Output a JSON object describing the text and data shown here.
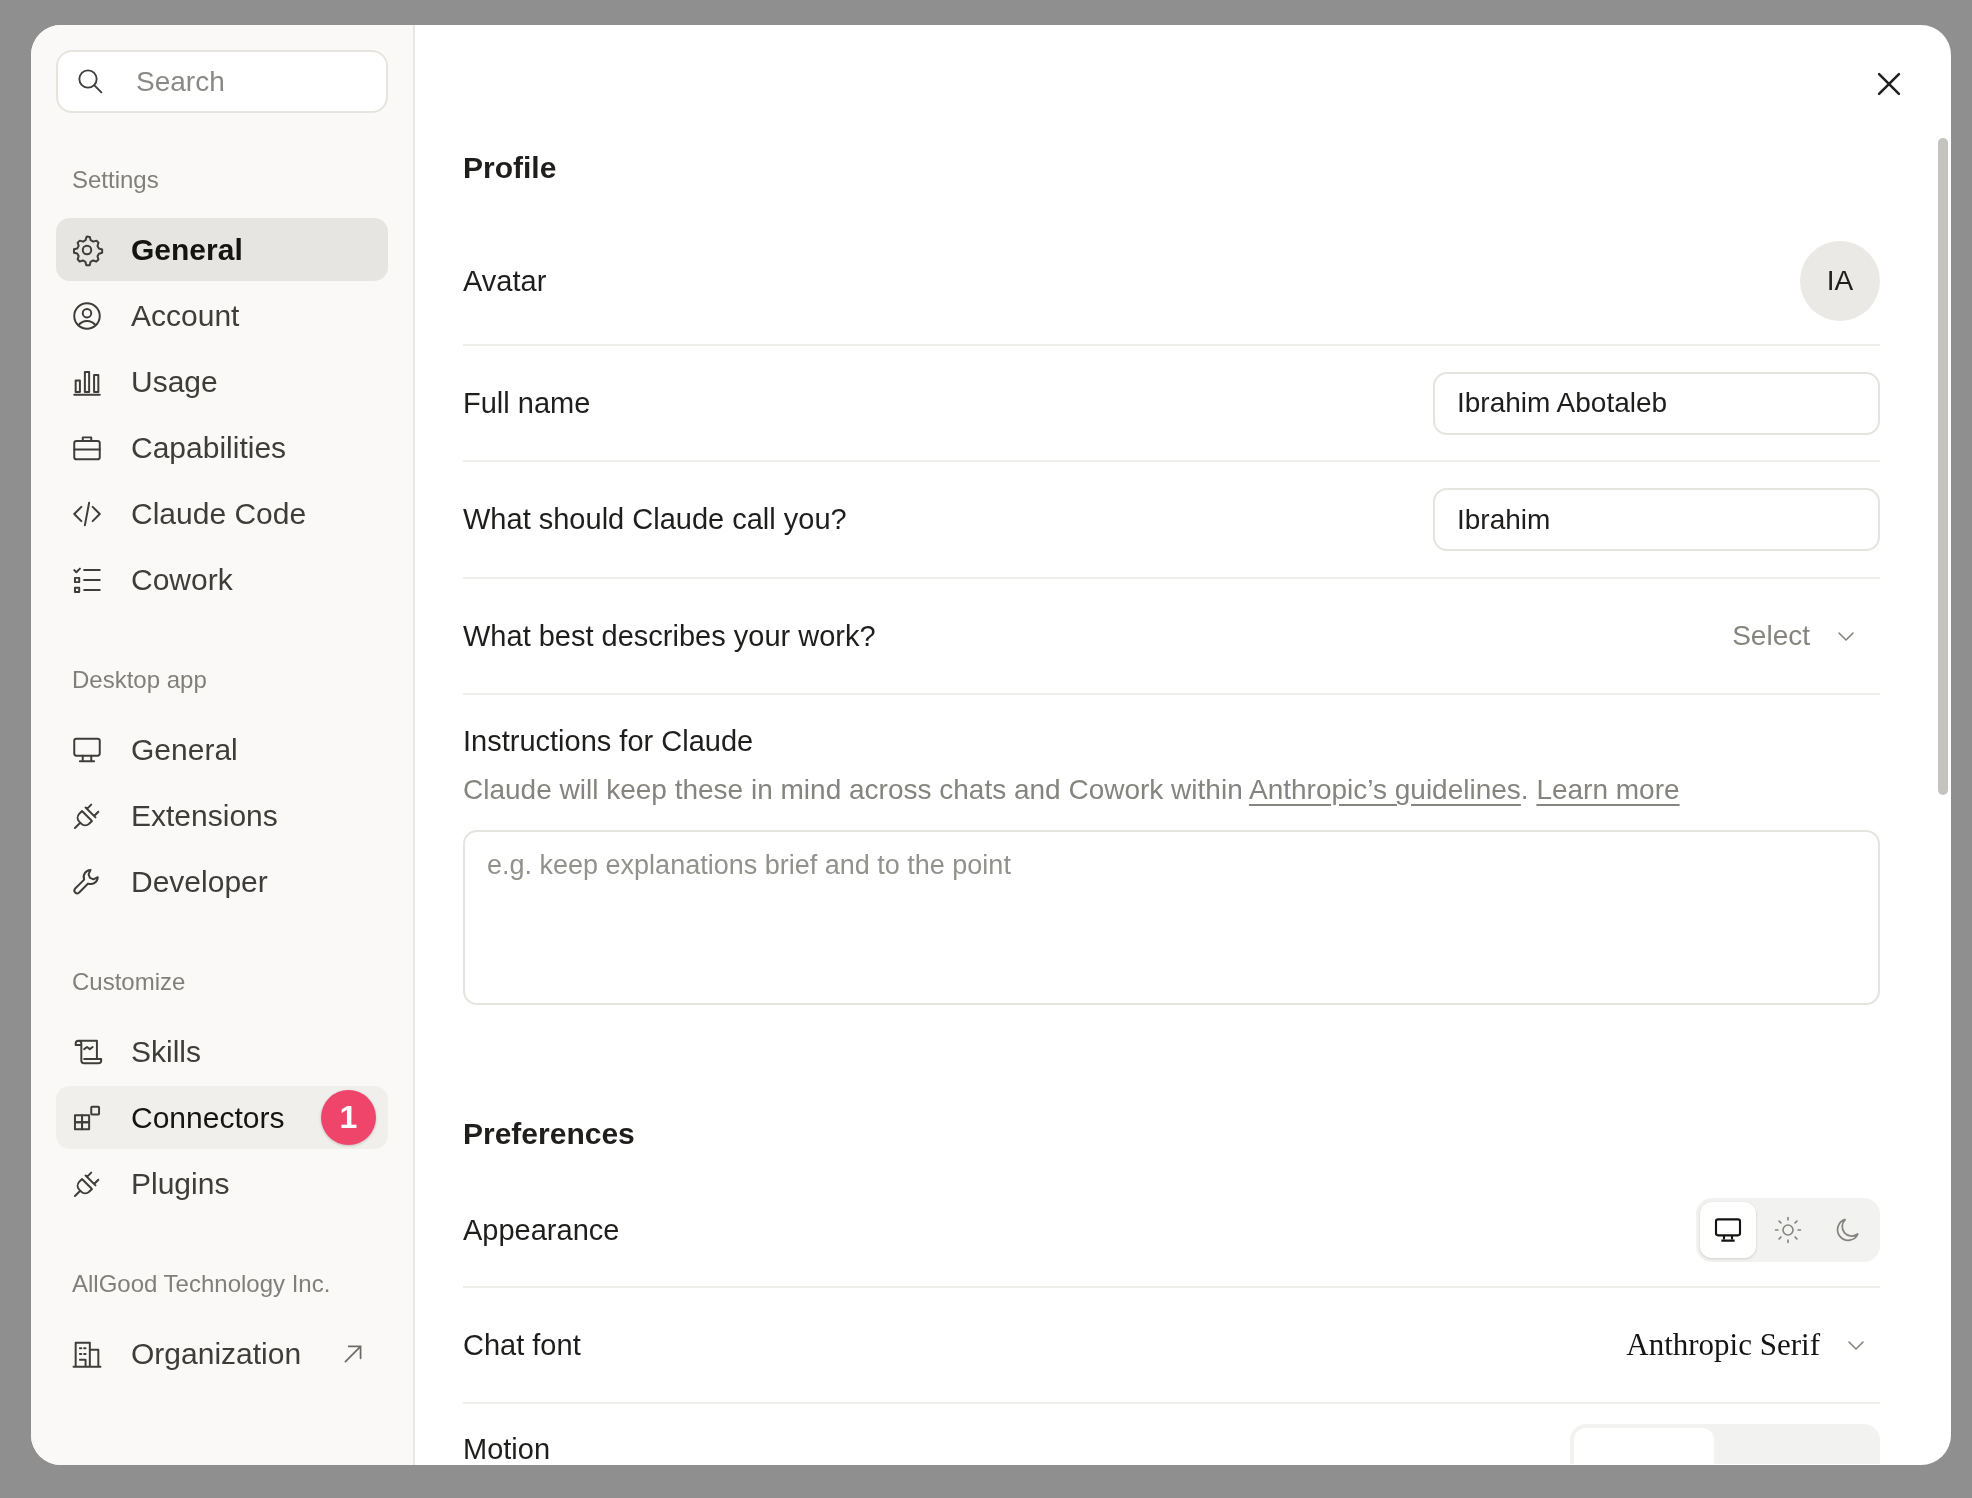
{
  "sidebar": {
    "search": {
      "placeholder": "Search"
    },
    "sections": [
      {
        "title": "Settings",
        "items": [
          {
            "label": "General",
            "selected": true,
            "hovered": false,
            "external": false
          },
          {
            "label": "Account",
            "selected": false,
            "hovered": false,
            "external": false
          },
          {
            "label": "Usage",
            "selected": false,
            "hovered": false,
            "external": false
          },
          {
            "label": "Capabilities",
            "selected": false,
            "hovered": false,
            "external": false
          },
          {
            "label": "Claude Code",
            "selected": false,
            "hovered": false,
            "external": false
          },
          {
            "label": "Cowork",
            "selected": false,
            "hovered": false,
            "external": false
          }
        ]
      },
      {
        "title": "Desktop app",
        "items": [
          {
            "label": "General",
            "selected": false,
            "hovered": false,
            "external": false
          },
          {
            "label": "Extensions",
            "selected": false,
            "hovered": false,
            "external": false
          },
          {
            "label": "Developer",
            "selected": false,
            "hovered": false,
            "external": false
          }
        ]
      },
      {
        "title": "Customize",
        "items": [
          {
            "label": "Skills",
            "selected": false,
            "hovered": false,
            "external": false
          },
          {
            "label": "Connectors",
            "selected": false,
            "hovered": true,
            "external": false,
            "badge": "1"
          },
          {
            "label": "Plugins",
            "selected": false,
            "hovered": false,
            "external": false
          }
        ]
      },
      {
        "title": "AllGood Technology Inc.",
        "items": [
          {
            "label": "Organization",
            "selected": false,
            "hovered": false,
            "external": true
          }
        ]
      }
    ]
  },
  "profile": {
    "heading": "Profile",
    "rows": [
      {
        "kind": "avatar",
        "label": "Avatar",
        "value": "IA"
      },
      {
        "kind": "text",
        "label": "Full name",
        "value": "Ibrahim Abotaleb"
      },
      {
        "kind": "text",
        "label": "What should Claude call you?",
        "value": "Ibrahim"
      },
      {
        "kind": "select",
        "label": "What best describes your work?",
        "placeholder": "Select"
      }
    ],
    "instructions": {
      "label": "Instructions for Claude",
      "description": [
        {
          "kind": "plain",
          "text": "Claude will keep these in mind across chats and Cowork within "
        },
        {
          "kind": "link",
          "text": "Anthropic’s guidelines"
        },
        {
          "kind": "plain",
          "text": ". "
        },
        {
          "kind": "link",
          "text": "Learn more"
        }
      ],
      "placeholder": "e.g. keep explanations brief and to the point"
    }
  },
  "preferences": {
    "heading": "Preferences",
    "rows": [
      {
        "kind": "appearance",
        "label": "Appearance",
        "options": [
          {
            "selected": true
          },
          {
            "selected": false
          },
          {
            "selected": false
          }
        ]
      },
      {
        "kind": "font",
        "label": "Chat font",
        "value": "Anthropic Serif"
      },
      {
        "kind": "toggle-cut",
        "label": "Motion"
      }
    ]
  }
}
